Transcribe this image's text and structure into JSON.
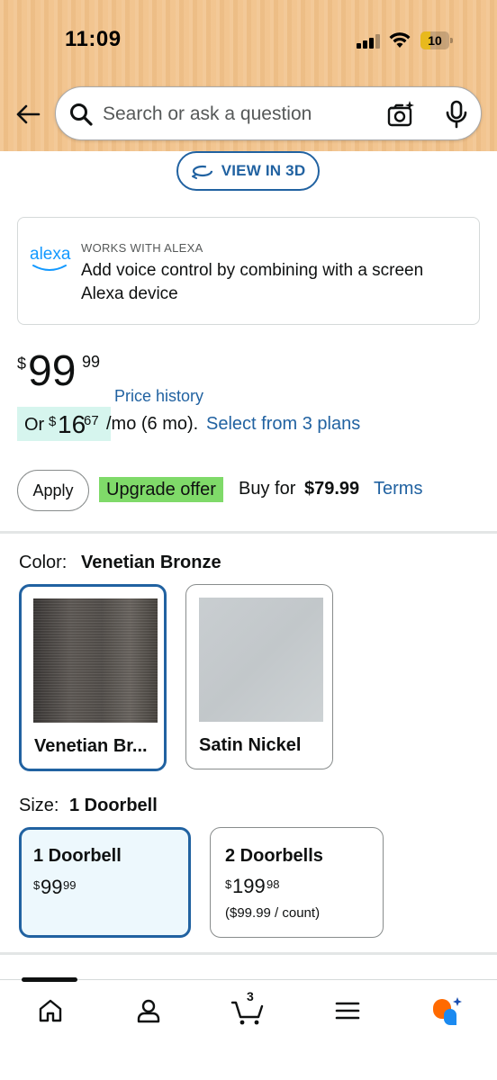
{
  "status_bar": {
    "time": "11:09",
    "battery_level": "10",
    "battery_fraction": 0.1
  },
  "header": {
    "search_placeholder": "Search or ask a question",
    "background_color": "#f2c38c"
  },
  "view_3d": {
    "label": "VIEW IN 3D"
  },
  "alexa": {
    "logo_text": "alexa",
    "kicker": "WORKS WITH ALEXA",
    "description": "Add voice control by combining with a screen Alexa device"
  },
  "price": {
    "symbol": "$",
    "whole": "99",
    "fraction": "99",
    "history_link": "Price history"
  },
  "monthly": {
    "prefix": "Or",
    "symbol": "$",
    "whole": "16",
    "fraction": "67",
    "suffix": "/mo (6 mo).",
    "plans_link": "Select from 3 plans"
  },
  "upgrade": {
    "apply_label": "Apply",
    "badge": "Upgrade offer",
    "buy_for": "Buy for",
    "buy_price": "$79.99",
    "terms_link": "Terms"
  },
  "color": {
    "label": "Color:",
    "selected": "Venetian Bronze",
    "options": [
      {
        "label": "Venetian Br...",
        "selected": true
      },
      {
        "label": "Satin Nickel",
        "selected": false
      }
    ]
  },
  "size": {
    "label": "Size:",
    "selected": "1 Doorbell",
    "options": [
      {
        "title": "1 Doorbell",
        "symbol": "$",
        "whole": "99",
        "fraction": "99",
        "note": "",
        "selected": true
      },
      {
        "title": "2 Doorbells",
        "symbol": "$",
        "whole": "199",
        "fraction": "98",
        "note": "($99.99 / count)",
        "selected": false
      }
    ]
  },
  "bottom_nav": {
    "cart_count": "3",
    "items": [
      "home-icon",
      "account-icon",
      "cart-icon",
      "menu-icon",
      "rufus-icon"
    ]
  },
  "colors": {
    "link": "#2162a1",
    "selected_border": "#2162a1",
    "monthly_chip": "#d6f5ee",
    "upgrade_badge": "#7fda69",
    "alexa_blue": "#1399ff"
  }
}
